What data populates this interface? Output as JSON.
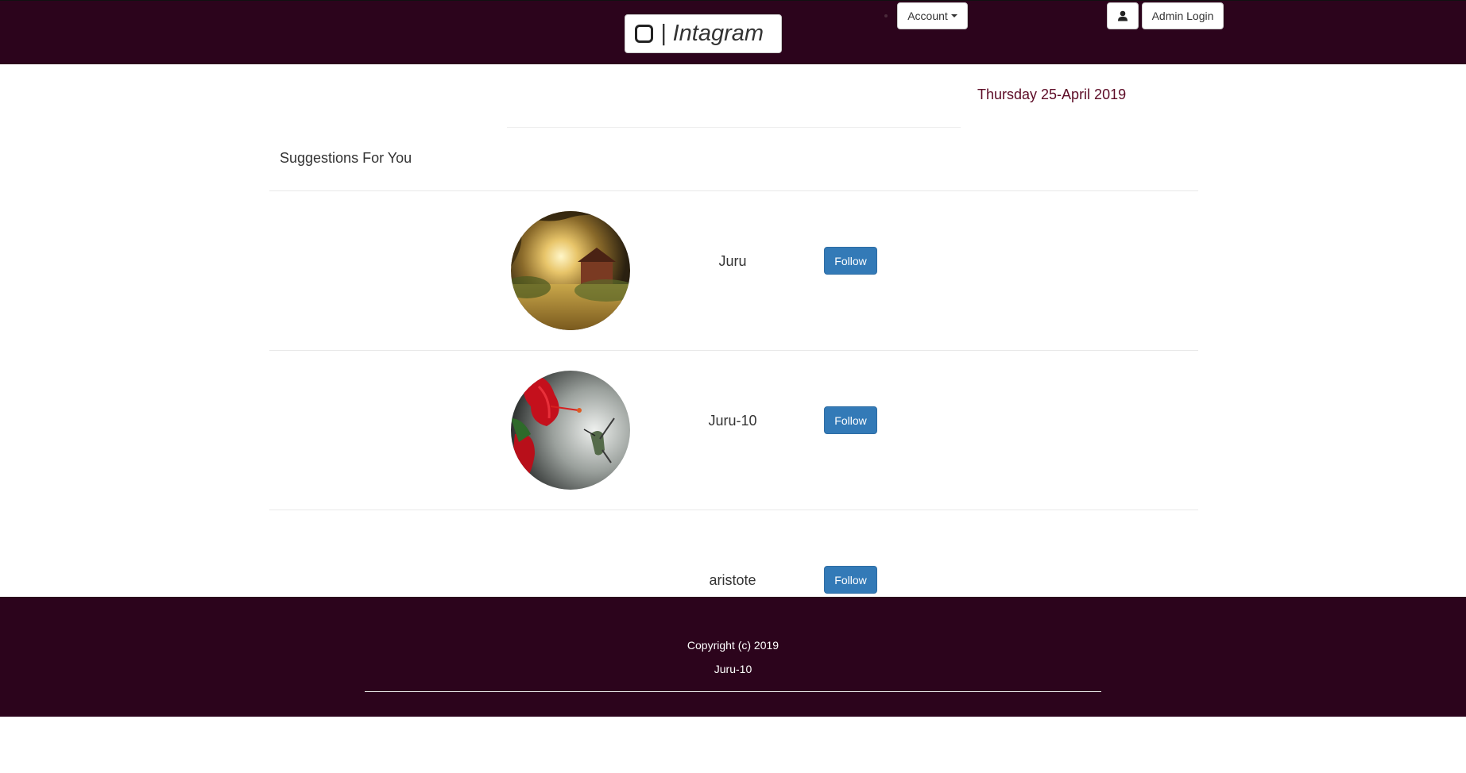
{
  "header": {
    "brand_text": "| Intagram",
    "account_label": "Account",
    "admin_login_label": "Admin Login",
    "colors": {
      "bar": "#2c041c"
    }
  },
  "main": {
    "date": "Thursday 25-April 2019",
    "section_title": "Suggestions For You",
    "suggestions": [
      {
        "username": "Juru",
        "follow_label": "Follow",
        "avatar": "sunlit-garden-photo"
      },
      {
        "username": "Juru-10",
        "follow_label": "Follow",
        "avatar": "hibiscus-hummingbird-photo"
      },
      {
        "username": "aristote",
        "follow_label": "Follow",
        "avatar": "none"
      }
    ],
    "colors": {
      "follow_button": "#337ab7",
      "date_text": "#5c0a25"
    }
  },
  "footer": {
    "copyright": "Copyright (c) 2019",
    "author": "Juru-10"
  },
  "icons": [
    "instagram-logo-icon",
    "chevron-down-icon",
    "user-icon"
  ]
}
